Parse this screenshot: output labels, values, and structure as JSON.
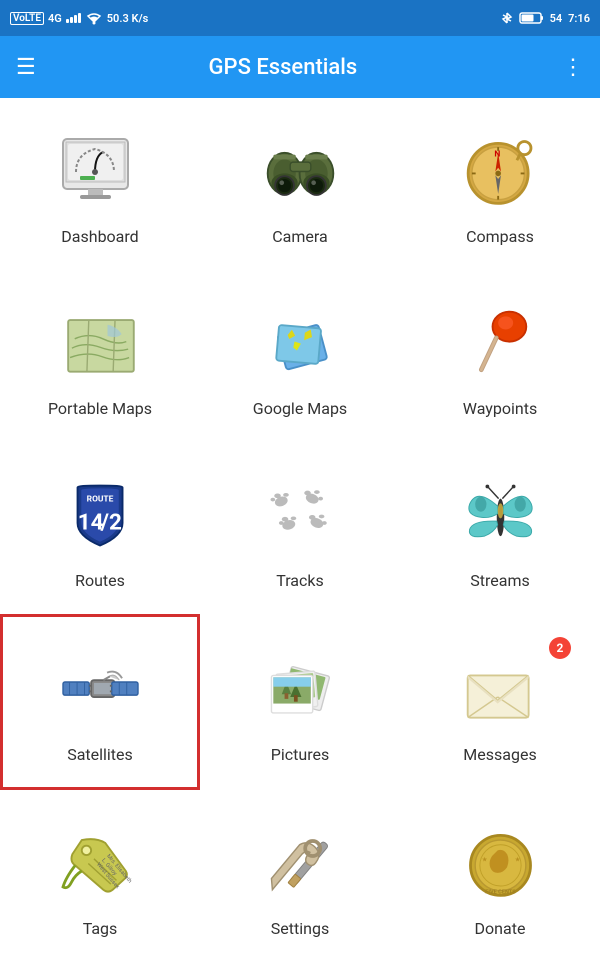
{
  "statusBar": {
    "operator": "VoLTE",
    "signal": "4G",
    "wifi": "WiFi",
    "speed": "50.3 K/s",
    "bluetooth": "BT",
    "battery": "54",
    "time": "7:16"
  },
  "appBar": {
    "title": "GPS Essentials",
    "menuLabel": "☰",
    "moreLabel": "⋮"
  },
  "grid": {
    "items": [
      {
        "id": "dashboard",
        "label": "Dashboard",
        "selected": false,
        "badge": 0
      },
      {
        "id": "camera",
        "label": "Camera",
        "selected": false,
        "badge": 0
      },
      {
        "id": "compass",
        "label": "Compass",
        "selected": false,
        "badge": 0
      },
      {
        "id": "portable-maps",
        "label": "Portable Maps",
        "selected": false,
        "badge": 0
      },
      {
        "id": "google-maps",
        "label": "Google Maps",
        "selected": false,
        "badge": 0
      },
      {
        "id": "waypoints",
        "label": "Waypoints",
        "selected": false,
        "badge": 0
      },
      {
        "id": "routes",
        "label": "Routes",
        "selected": false,
        "badge": 0
      },
      {
        "id": "tracks",
        "label": "Tracks",
        "selected": false,
        "badge": 0
      },
      {
        "id": "streams",
        "label": "Streams",
        "selected": false,
        "badge": 0
      },
      {
        "id": "satellites",
        "label": "Satellites",
        "selected": true,
        "badge": 0
      },
      {
        "id": "pictures",
        "label": "Pictures",
        "selected": false,
        "badge": 0
      },
      {
        "id": "messages",
        "label": "Messages",
        "selected": false,
        "badge": 2
      },
      {
        "id": "tags",
        "label": "Tags",
        "selected": false,
        "badge": 0
      },
      {
        "id": "settings",
        "label": "Settings",
        "selected": false,
        "badge": 0
      },
      {
        "id": "donate",
        "label": "Donate",
        "selected": false,
        "badge": 0
      }
    ]
  }
}
